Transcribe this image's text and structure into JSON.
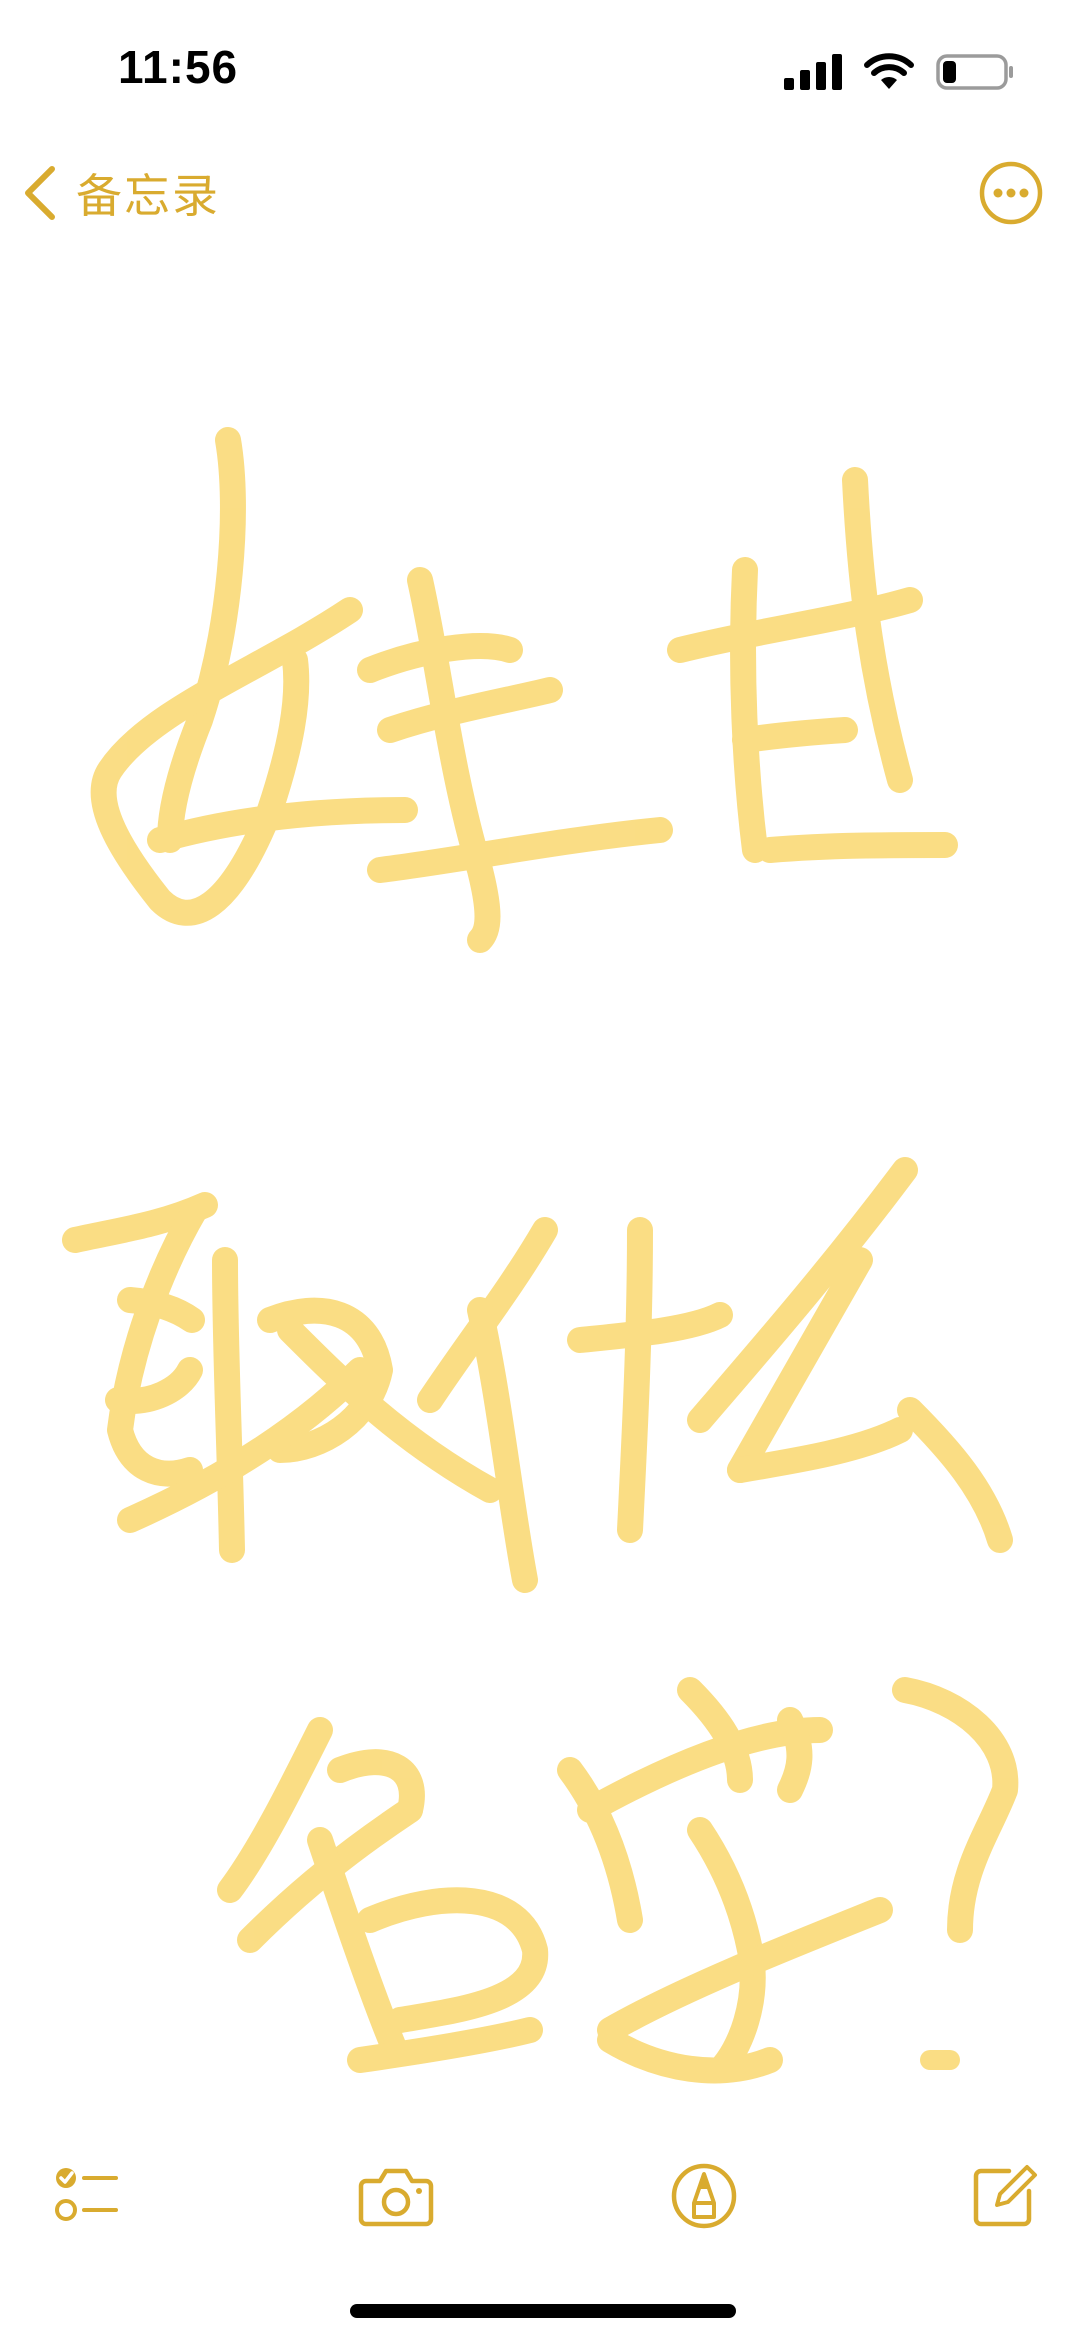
{
  "status_bar": {
    "time": "11:56",
    "icons": [
      "cellular-signal-icon",
      "wifi-icon",
      "battery-icon"
    ]
  },
  "nav": {
    "back_label": "备忘录",
    "back_icon": "chevron-left-icon",
    "more_icon": "ellipsis-circle-icon"
  },
  "note": {
    "handwriting_lines": [
      "姓甘",
      "取什么",
      "名字？"
    ],
    "ink_color": "#f9d66a"
  },
  "toolbar": {
    "items": [
      "checklist-icon",
      "camera-icon",
      "markup-pen-icon",
      "compose-icon"
    ]
  },
  "colors": {
    "accent": "#d9ab2f",
    "background": "#ffffff"
  }
}
